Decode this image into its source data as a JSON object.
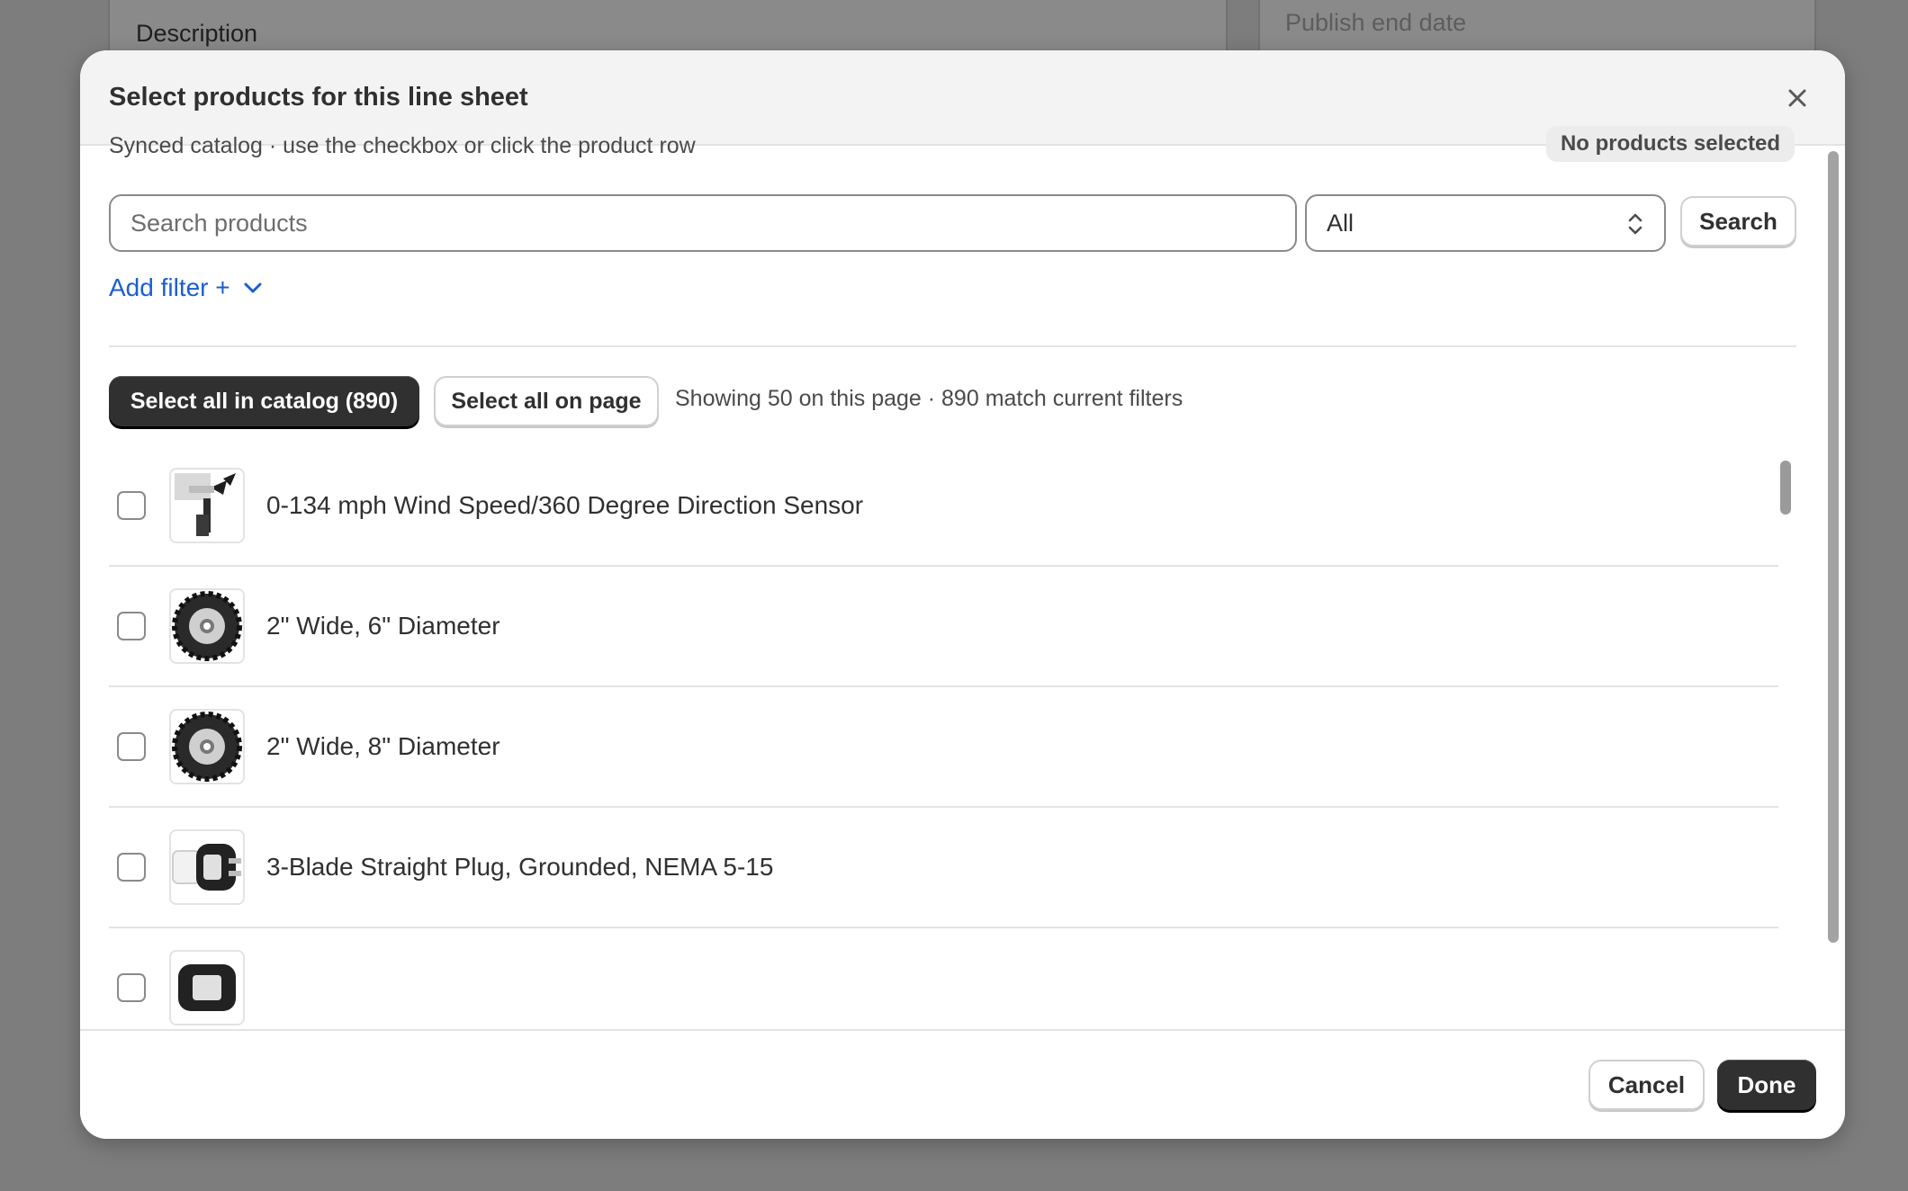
{
  "background": {
    "description_label": "Description",
    "publish_end_label": "Publish end date"
  },
  "modal": {
    "title": "Select products for this line sheet",
    "subtitle": "Synced catalog · use the checkbox or click the product row",
    "status_badge": "No products selected",
    "search": {
      "placeholder": "Search products",
      "value": ""
    },
    "filter_select": {
      "value": "All"
    },
    "search_button": "Search",
    "add_filter": "Add filter +",
    "select_all_catalog": "Select all in catalog (890)",
    "select_all_page": "Select all on page",
    "showing_text": "Showing 50 on this page · 890 match current filters",
    "products": [
      {
        "name": "0-134 mph Wind Speed/360 Degree Direction Sensor",
        "thumb_icon": "wind-sensor",
        "checked": false
      },
      {
        "name": "2\" Wide, 6\" Diameter",
        "thumb_icon": "wheel",
        "checked": false
      },
      {
        "name": "2\" Wide, 8\" Diameter",
        "thumb_icon": "wheel",
        "checked": false
      },
      {
        "name": "3-Blade Straight Plug, Grounded, NEMA 5-15",
        "thumb_icon": "plug",
        "checked": false
      },
      {
        "name": "",
        "thumb_icon": "plug",
        "checked": false
      }
    ],
    "footer": {
      "cancel": "Cancel",
      "done": "Done"
    }
  },
  "colors": {
    "accent_link": "#1a5fcf",
    "primary_button": "#303030",
    "overlay": "#7d7d7d"
  }
}
